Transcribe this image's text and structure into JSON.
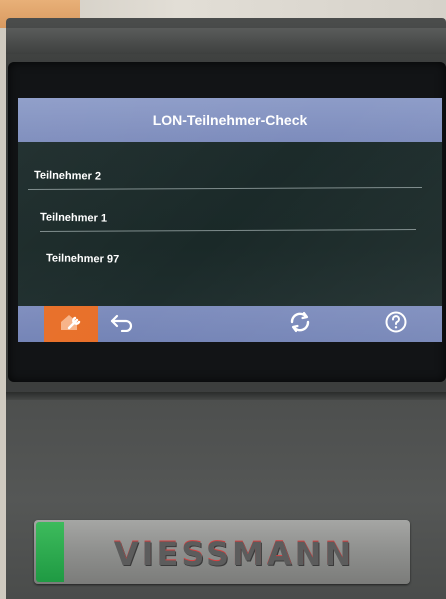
{
  "screen": {
    "title": "LON-Teilnehmer-Check",
    "items": [
      {
        "label": "Teilnehmer 2"
      },
      {
        "label": "Teilnehmer 1"
      },
      {
        "label": "Teilnehmer 97"
      }
    ]
  },
  "toolbar": {
    "buttons": [
      {
        "icon": "wrench-house-icon"
      },
      {
        "icon": "back-arrow-icon"
      },
      {
        "icon": "refresh-icon"
      },
      {
        "icon": "help-icon"
      }
    ]
  },
  "brand": {
    "logo_text": "VIESSMANN"
  },
  "colors": {
    "title_bar": "#8d9cc8",
    "bottom_bar": "#7f8ebe",
    "accent_orange": "#e8702a",
    "screen_bg": "#1d2c2c",
    "logo_red": "#d64040",
    "logo_green": "#2aa94e"
  }
}
